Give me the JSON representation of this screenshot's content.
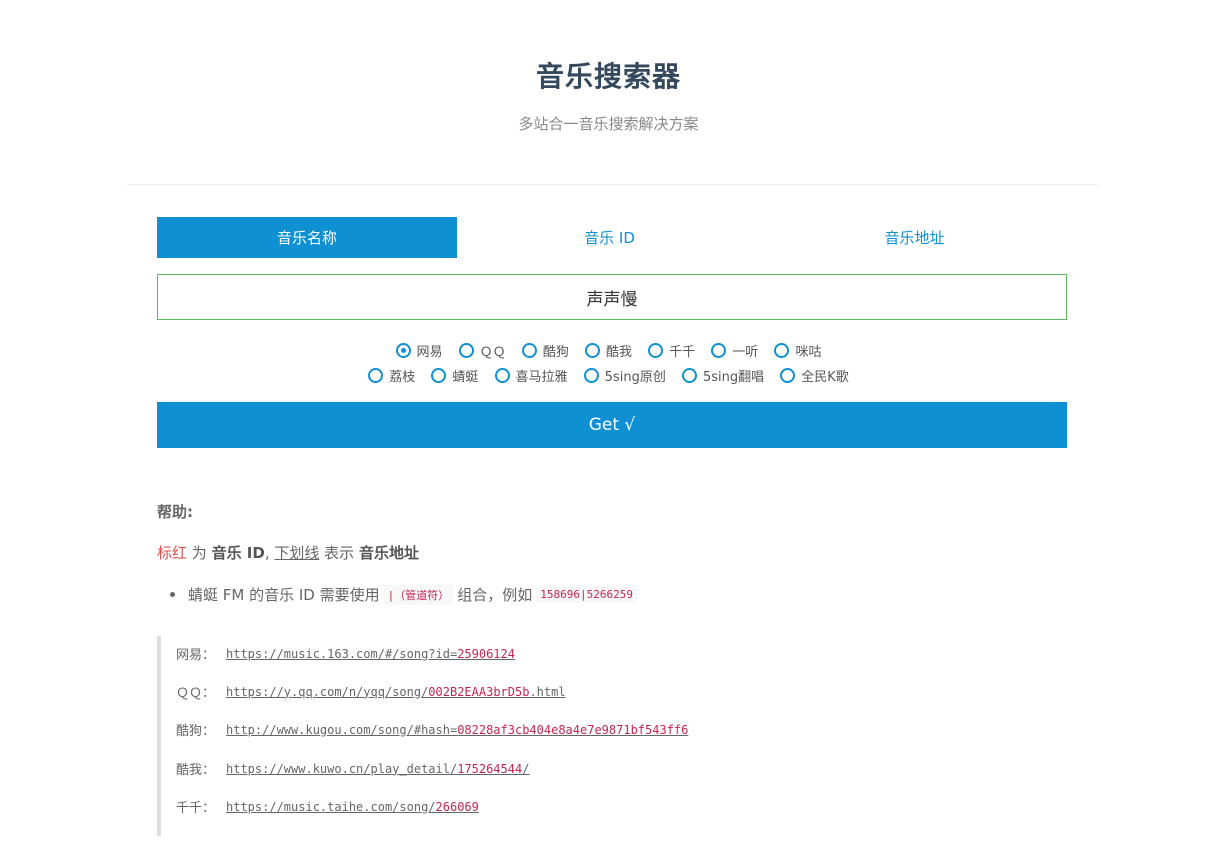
{
  "header": {
    "title": "音乐搜索器",
    "subtitle": "多站合一音乐搜索解决方案"
  },
  "tabs": [
    {
      "label": "音乐名称",
      "active": true
    },
    {
      "label": "音乐 ID",
      "active": false
    },
    {
      "label": "音乐地址",
      "active": false
    }
  ],
  "search": {
    "value": "声声慢"
  },
  "sources_row1": [
    {
      "label": "网易",
      "checked": true
    },
    {
      "label": "ＱＱ",
      "checked": false
    },
    {
      "label": "酷狗",
      "checked": false
    },
    {
      "label": "酷我",
      "checked": false
    },
    {
      "label": "千千",
      "checked": false
    },
    {
      "label": "一听",
      "checked": false
    },
    {
      "label": "咪咕",
      "checked": false
    }
  ],
  "sources_row2": [
    {
      "label": "荔枝",
      "checked": false
    },
    {
      "label": "蜻蜓",
      "checked": false
    },
    {
      "label": "喜马拉雅",
      "checked": false
    },
    {
      "label": "5sing原创",
      "checked": false
    },
    {
      "label": "5sing翻唱",
      "checked": false
    },
    {
      "label": "全民K歌",
      "checked": false
    }
  ],
  "get_button": {
    "label": "Get √"
  },
  "help": {
    "title": "帮助:",
    "red_text": "标红",
    "is_text": " 为 ",
    "bold1": "音乐 ID",
    "comma": ", ",
    "underline_text": "下划线",
    "means_text": " 表示 ",
    "bold2": "音乐地址",
    "bullet_pre": "蜻蜓 FM 的音乐 ID 需要使用",
    "bullet_code1": "|（管道符）",
    "bullet_mid": "组合，例如",
    "bullet_code2": "158696|5266259"
  },
  "examples": [
    {
      "label": "网易：",
      "url_plain": "https://music.163.com/#/song?id=",
      "url_id": "25906124",
      "url_tail": ""
    },
    {
      "label": "ＱＱ：",
      "url_plain": "https://y.qq.com/n/yqq/song/",
      "url_id": "002B2EAA3brD5b",
      "url_tail": ".html"
    },
    {
      "label": "酷狗：",
      "url_plain": "http://www.kugou.com/song/#hash=",
      "url_id": "08228af3cb404e8a4e7e9871bf543ff6",
      "url_tail": ""
    },
    {
      "label": "酷我：",
      "url_plain": "https://www.kuwo.cn/play_detail/",
      "url_id": "175264544",
      "url_tail": "/"
    },
    {
      "label": "千千：",
      "url_plain": "https://music.taihe.com/song/",
      "url_id": "266069",
      "url_tail": ""
    }
  ]
}
